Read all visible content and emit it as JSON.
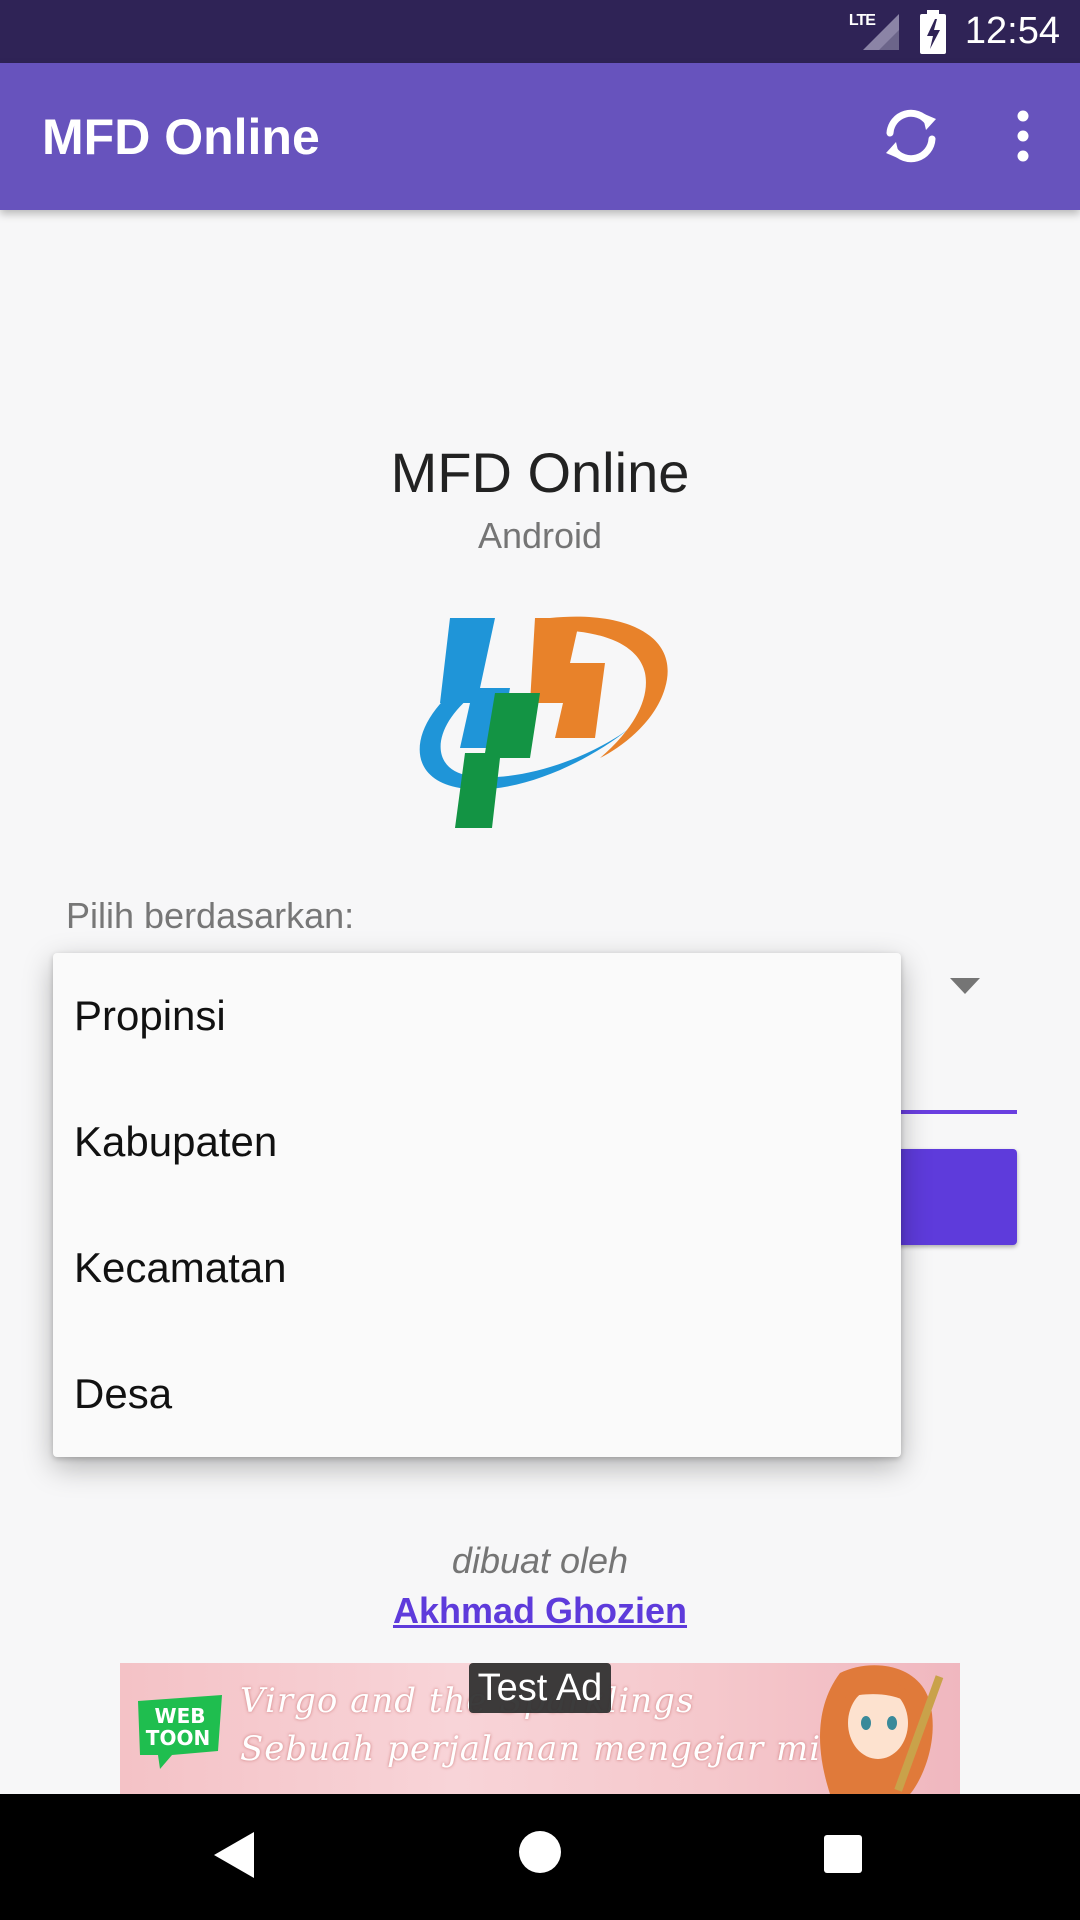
{
  "status_bar": {
    "network_label": "LTE",
    "time": "12:54"
  },
  "app_bar": {
    "title": "MFD Online",
    "sync_icon": "sync-icon",
    "more_icon": "more-vert-icon"
  },
  "content": {
    "title": "MFD Online",
    "subtitle": "Android",
    "select_label": "Pilih berdasarkan:"
  },
  "dropdown": {
    "options": [
      "Propinsi",
      "Kabupaten",
      "Kecamatan",
      "Desa"
    ]
  },
  "credits": {
    "label": "dibuat oleh",
    "author": "Akhmad Ghozien"
  },
  "ad": {
    "badge": "Test Ad",
    "logo_line1": "WEB",
    "logo_line2": "TOON",
    "line1": "Virgo and the Sparklings",
    "line2": "Sebuah perjalanan mengejar mimpi"
  },
  "colors": {
    "status_bar": "#2f2356",
    "app_bar": "#6753bd",
    "accent": "#5e3bdb",
    "background": "#f7f7f8"
  }
}
